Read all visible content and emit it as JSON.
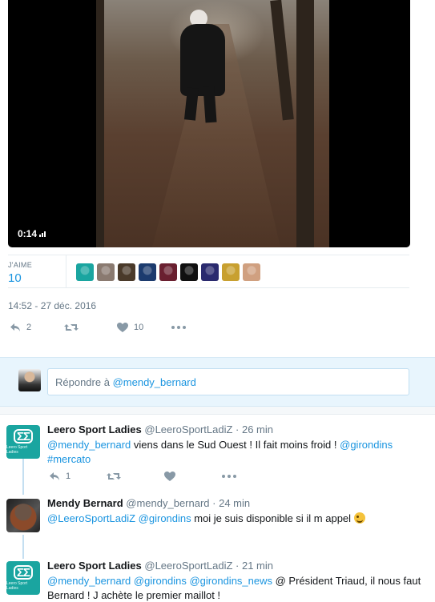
{
  "video": {
    "time": "0:14",
    "time_icon": "volume-bars-icon"
  },
  "stats": {
    "likes_label": "J'AIME",
    "likes_count": "10",
    "liker_avatars": [
      {
        "name": "leero-avatar",
        "color": "#1aa5a0"
      },
      {
        "name": "user-avatar-2",
        "color": "#8a7a70"
      },
      {
        "name": "user-avatar-3",
        "color": "#4a3a2a"
      },
      {
        "name": "user-avatar-4",
        "color": "#1c3b6e"
      },
      {
        "name": "user-avatar-5",
        "color": "#6a2030"
      },
      {
        "name": "user-avatar-6",
        "color": "#101010"
      },
      {
        "name": "user-avatar-7",
        "color": "#2a2a6e"
      },
      {
        "name": "user-avatar-8",
        "color": "#c8a030"
      },
      {
        "name": "user-avatar-9",
        "color": "#d0a080"
      }
    ]
  },
  "main_tweet": {
    "timestamp": "14:52 - 27 déc. 2016",
    "reply_count": "2",
    "retweet_count": "",
    "like_count": "10"
  },
  "reply_box": {
    "prefix": "Répondre à",
    "mention": "@mendy_bernard"
  },
  "tweets": [
    {
      "name": "Leero Sport Ladies",
      "handle": "@LeeroSportLadiZ",
      "time": "· 26 min",
      "avatar_sub": "Leero Sport Ladies",
      "reply_count": "1",
      "parts": [
        {
          "text": "@mendy_bernard",
          "link": true
        },
        {
          "text": " viens dans le Sud Ouest ! Il fait moins froid ! ",
          "link": false
        },
        {
          "text": "@girondins",
          "link": true
        },
        {
          "text": "#mercato",
          "link": true
        }
      ]
    },
    {
      "name": "Mendy Bernard",
      "handle": "@mendy_bernard",
      "time": "· 24 min",
      "parts": [
        {
          "text": "@LeeroSportLadiZ",
          "link": true
        },
        {
          "text": " ",
          "link": false
        },
        {
          "text": "@girondins",
          "link": true
        },
        {
          "text": " moi je suis disponible si il m appel ",
          "link": false
        }
      ],
      "emoji": "winking-face-emoji"
    },
    {
      "name": "Leero Sport Ladies",
      "handle": "@LeeroSportLadiZ",
      "time": "· 21 min",
      "avatar_sub": "Leero Sport Ladies",
      "parts": [
        {
          "text": "@mendy_bernard",
          "link": true
        },
        {
          "text": " ",
          "link": false
        },
        {
          "text": "@girondins",
          "link": true
        },
        {
          "text": " ",
          "link": false
        },
        {
          "text": "@girondins_news",
          "link": true
        },
        {
          "text": " @ Président Triaud, il nous faut Bernard ! J achète le premier maillot !",
          "link": false
        }
      ]
    }
  ],
  "colors": {
    "link": "#1b95e0",
    "muted": "#657786",
    "leero_brand": "#1aa5a0",
    "reply_bg": "#e8f5fd"
  }
}
